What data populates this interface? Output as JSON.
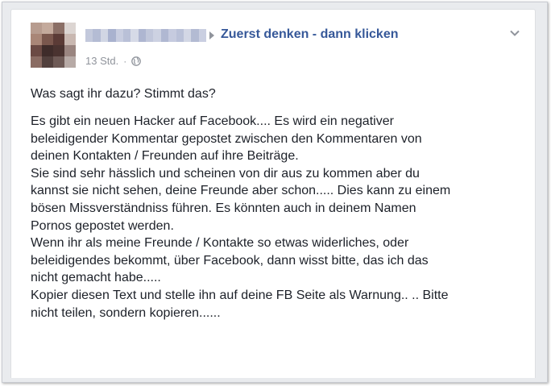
{
  "post": {
    "group_name": "Zuerst denken - dann klicken",
    "timestamp": "13 Std.",
    "separator": "·",
    "privacy_icon": "globe-icon",
    "menu_icon": "chevron-down-icon",
    "question": "Was sagt ihr dazu? Stimmt das?",
    "body_lines": [
      "Es gibt ein neuen Hacker auf Facebook.... Es wird ein negativer",
      "beleidigender Kommentar gepostet zwischen den Kommentaren von",
      "deinen Kontakten / Freunden auf ihre Beiträge.",
      "Sie sind sehr hässlich und scheinen von dir aus zu kommen aber du",
      "kannst sie nicht sehen, deine Freunde aber schon..... Dies kann zu einem",
      "bösen Missverständniss führen. Es könnten auch in deinem Namen",
      "Pornos gepostet werden.",
      "Wenn ihr als meine Freunde / Kontakte so etwas widerliches, oder",
      "beleidigendes bekommt, über Facebook, dann wisst bitte, das ich das",
      "nicht gemacht habe.....",
      "Kopier diesen Text und stelle ihn auf deine FB Seite als Warnung.. .. Bitte",
      "nicht teilen, sondern kopieren......"
    ]
  },
  "colors": {
    "link": "#365899",
    "text": "#1d2129",
    "meta": "#90949c",
    "background": "#e9ebee"
  }
}
